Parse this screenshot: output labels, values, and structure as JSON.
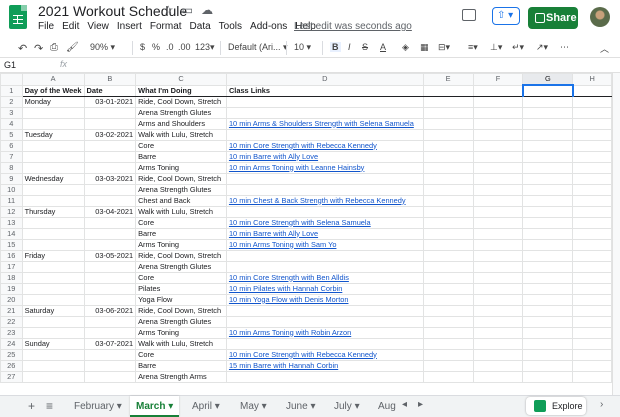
{
  "app": {
    "doc_title": "2021 Workout Schedule",
    "menu": [
      "File",
      "Edit",
      "View",
      "Insert",
      "Format",
      "Data",
      "Tools",
      "Add-ons",
      "Help"
    ],
    "last_edit": "Last edit was seconds ago",
    "share_label": "Share",
    "accent_color": "#188038"
  },
  "toolbar": {
    "zoom": "90%",
    "currency": "$",
    "percent": "%",
    "decimal_less": ".0",
    "decimal_more": ".00",
    "number_format": "123",
    "font": "Default (Ari...",
    "font_size": "10",
    "bold": "B",
    "italic": "I",
    "strike": "S",
    "text_color": "A"
  },
  "formula_bar": {
    "cell_ref": "G1",
    "fx": "fx",
    "value": ""
  },
  "columns": [
    "A",
    "B",
    "C",
    "D",
    "E",
    "F",
    "G",
    "H"
  ],
  "header_row": [
    "Day of the Week",
    "Date",
    "What I'm Doing",
    "Class Links"
  ],
  "rows": [
    [
      "Monday",
      "03-01-2021",
      "Ride, Cool Down, Stretch",
      ""
    ],
    [
      "",
      "",
      "Arena Strength Glutes",
      ""
    ],
    [
      "",
      "",
      "Arms and Shoulders",
      "10 min Arms & Shoulders Strength with Selena Samuela"
    ],
    [
      "Tuesday",
      "03-02-2021",
      "Walk with Lulu, Stretch",
      ""
    ],
    [
      "",
      "",
      "Core",
      "10 min Core Strength with Rebecca Kennedy"
    ],
    [
      "",
      "",
      "Barre",
      "10 min Barre with Ally Love"
    ],
    [
      "",
      "",
      "Arms Toning",
      "10 min Arms Toning with Leanne Hainsby"
    ],
    [
      "Wednesday",
      "03-03-2021",
      "Ride, Cool Down, Stretch",
      ""
    ],
    [
      "",
      "",
      "Arena Strength Glutes",
      ""
    ],
    [
      "",
      "",
      "Chest and Back",
      "10 min Chest & Back Strength with Rebecca Kennedy"
    ],
    [
      "Thursday",
      "03-04-2021",
      "Walk with Lulu, Stretch",
      ""
    ],
    [
      "",
      "",
      "Core",
      "10 min Core Strength with Selena Samuela"
    ],
    [
      "",
      "",
      "Barre",
      "10 min Barre with Ally Love"
    ],
    [
      "",
      "",
      "Arms Toning",
      "10 min Arms Toning with Sam Yo"
    ],
    [
      "Friday",
      "03-05-2021",
      "Ride, Cool Down, Stretch",
      ""
    ],
    [
      "",
      "",
      "Arena Strength Glutes",
      ""
    ],
    [
      "",
      "",
      "Core",
      "10 min Core Strength with Ben Alldis"
    ],
    [
      "",
      "",
      "Pilates",
      "10 min Pilates with Hannah Corbin"
    ],
    [
      "",
      "",
      "Yoga Flow",
      "10 min Yoga Flow with Denis Morton"
    ],
    [
      "Saturday",
      "03-06-2021",
      "Ride, Cool Down, Stretch",
      ""
    ],
    [
      "",
      "",
      "Arena Strength Glutes",
      ""
    ],
    [
      "",
      "",
      "Arms Toning",
      "10 min Arms Toning with Robin Arzon"
    ],
    [
      "Sunday",
      "03-07-2021",
      "Walk with Lulu, Stretch",
      ""
    ],
    [
      "",
      "",
      "Core",
      "10 min Core Strength with Rebecca Kennedy"
    ],
    [
      "",
      "",
      "Barre",
      "15 min Barre with Hannah Corbin"
    ],
    [
      "",
      "",
      "Arena Strength Arms",
      ""
    ]
  ],
  "sheet_tabs": [
    "February",
    "March",
    "April",
    "May",
    "June",
    "July",
    "Aug"
  ],
  "active_tab": "March",
  "explore_label": "Explore"
}
